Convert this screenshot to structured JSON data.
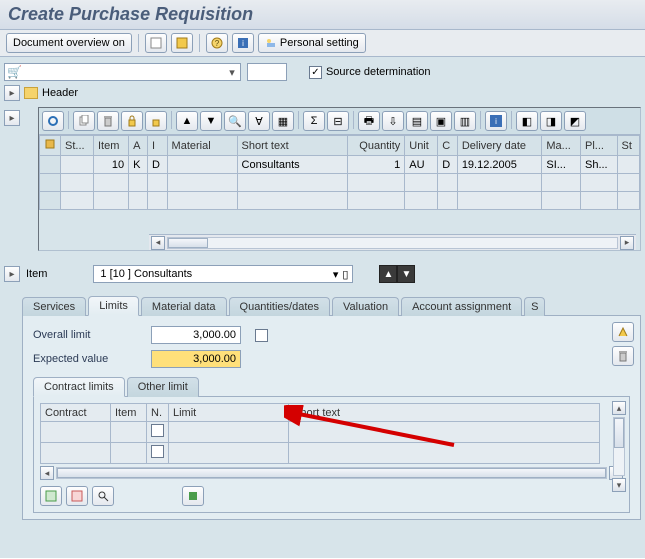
{
  "title": "Create Purchase Requisition",
  "toolbar": {
    "doc_overview_on": "Document overview on",
    "personal_setting": "Personal setting"
  },
  "topbar": {
    "doc_type": "",
    "source_determination": "Source determination",
    "source_checked": true
  },
  "header_expander": "Header",
  "item_expander": "Item",
  "grid": {
    "cols": [
      "St...",
      "Item",
      "A",
      "I",
      "Material",
      "Short text",
      "Quantity",
      "Unit",
      "C",
      "Delivery date",
      "Ma...",
      "Pl...",
      "St"
    ],
    "rows": [
      {
        "status": "",
        "item": "10",
        "a": "K",
        "i": "D",
        "material": "",
        "short": "Consultants",
        "qty": "1",
        "unit": "AU",
        "c": "D",
        "deliv": "19.12.2005",
        "ma": "SI...",
        "pl": "Sh...",
        "st": ""
      }
    ]
  },
  "item_section": {
    "selected": "1 [10 ] Consultants"
  },
  "tabs": [
    "Services",
    "Limits",
    "Material data",
    "Quantities/dates",
    "Valuation",
    "Account assignment",
    "S"
  ],
  "active_tab": "Limits",
  "limits": {
    "overall_limit_label": "Overall limit",
    "overall_limit": "3,000.00",
    "expected_value_label": "Expected value",
    "expected_value": "3,000.00",
    "inner_tabs": [
      "Contract limits",
      "Other limit"
    ],
    "active_inner": "Contract limits",
    "inner_cols": [
      "Contract",
      "Item",
      "N.",
      "Limit",
      "Short text"
    ]
  }
}
